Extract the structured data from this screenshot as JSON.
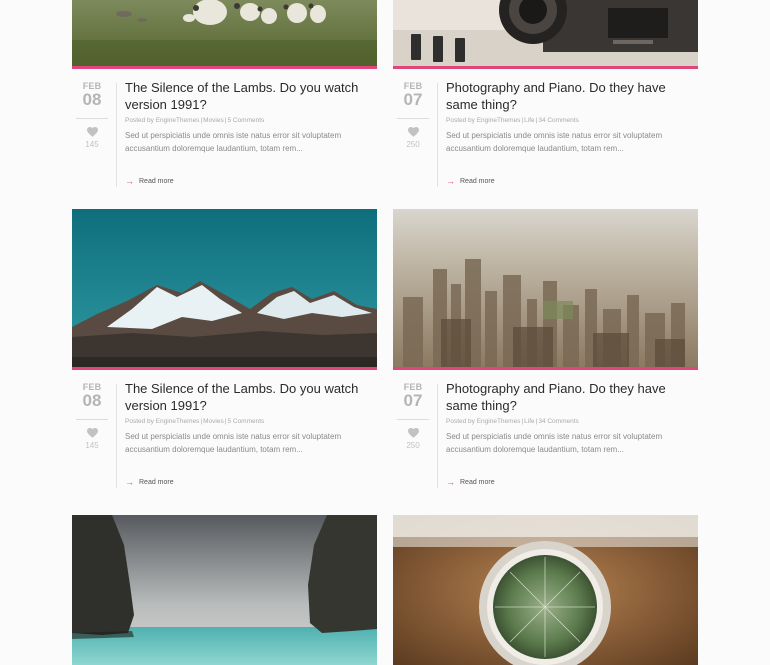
{
  "read_more_label": "Read more",
  "posts": [
    {
      "image": "sheep-field",
      "month": "FEB",
      "day": "08",
      "likes": "145",
      "title": "The Silence of the Lambs. Do you watch version 1991?",
      "author": "Posted by EngineThemes",
      "category": "Movies",
      "comments": "5 Comments",
      "excerpt": "Sed ut perspiciatis unde omnis iste natus error sit voluptatem accusantium doloremque laudantium, totam rem..."
    },
    {
      "image": "camera-piano",
      "month": "FEB",
      "day": "07",
      "likes": "250",
      "title": "Photography and Piano. Do they have same thing?",
      "author": "Posted by EngineThemes",
      "category": "Life",
      "comments": "34 Comments",
      "excerpt": "Sed ut perspiciatis unde omnis iste natus error sit voluptatem accusantium doloremque laudantium, totam rem..."
    },
    {
      "image": "snowy-mountains",
      "month": "FEB",
      "day": "08",
      "likes": "145",
      "title": "The Silence of the Lambs. Do you watch version 1991?",
      "author": "Posted by EngineThemes",
      "category": "Movies",
      "comments": "5 Comments",
      "excerpt": "Sed ut perspiciatis unde omnis iste natus error sit voluptatem accusantium doloremque laudantium, totam rem..."
    },
    {
      "image": "city-aerial",
      "month": "FEB",
      "day": "07",
      "likes": "250",
      "title": "Photography and Piano. Do they have same thing?",
      "author": "Posted by EngineThemes",
      "category": "Life",
      "comments": "34 Comments",
      "excerpt": "Sed ut perspiciatis unde omnis iste natus error sit voluptatem accusantium doloremque laudantium, totam rem..."
    },
    {
      "image": "sea-cliffs"
    },
    {
      "image": "cactus-pot"
    }
  ],
  "colors": {
    "accent": "#e0457b",
    "date_text": "#b5b5b5",
    "title_text": "#2b2b2b",
    "excerpt_text": "#8a8a8a"
  }
}
